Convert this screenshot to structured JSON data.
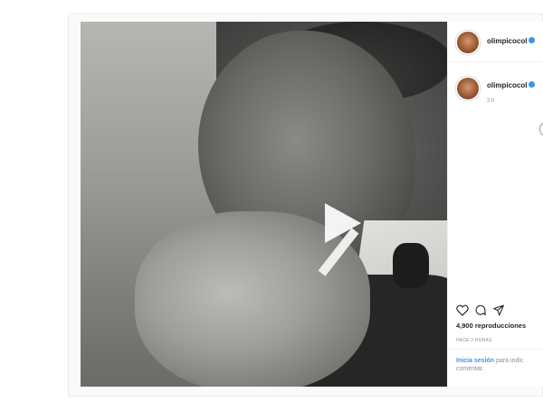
{
  "post": {
    "author": "olimpicocol",
    "comment_author": "olimpicocol",
    "comment_age": "2 h",
    "views": "4,900 reproducciones",
    "posted": "HACE 2 HORAS",
    "login_link": "Inicia sesión",
    "login_rest": "para indic",
    "login_rest2": "comentar."
  },
  "icons": [
    "play-icon",
    "heart-icon",
    "comment-icon",
    "share-icon",
    "verified-icon",
    "more-icon"
  ],
  "colors": {
    "link": "#3897f0",
    "verified": "#3897f0",
    "text": "#262626",
    "muted": "#8e8e8e"
  }
}
